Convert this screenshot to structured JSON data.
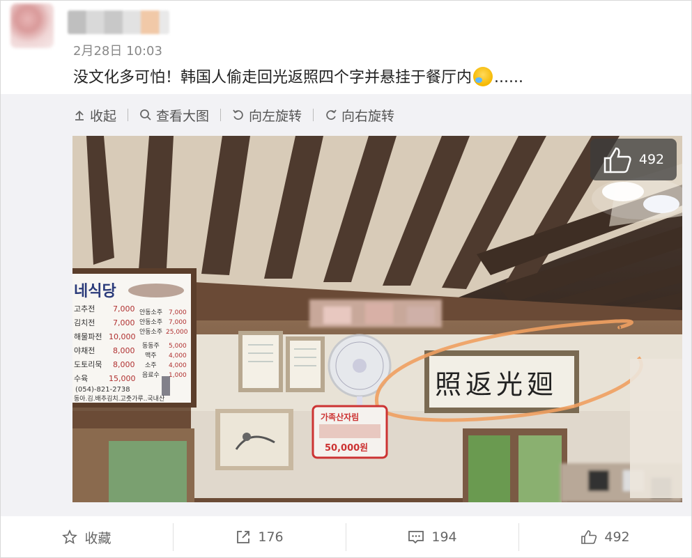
{
  "post": {
    "timestamp": "2月28日 10:03",
    "text": "没文化多可怕！韩国人偷走回光返照四个字并悬挂于餐厅内",
    "ellipsis": "......"
  },
  "toolbar": {
    "collapse": "收起",
    "view_large": "查看大图",
    "rotate_left": "向左旋转",
    "rotate_right": "向右旋转"
  },
  "photo": {
    "like_count": "492",
    "banner_text": "照返光廻",
    "menu_title": "네식당",
    "menu_items": [
      {
        "name": "고추전",
        "price": "7,000"
      },
      {
        "name": "김치전",
        "price": "7,000"
      },
      {
        "name": "해물파전",
        "price": "10,000"
      },
      {
        "name": "야채전",
        "price": "8,000"
      },
      {
        "name": "도토리묵",
        "price": "8,000"
      },
      {
        "name": "수육",
        "price": "15,000"
      }
    ],
    "menu_right": [
      {
        "name": "안동소주",
        "price": "7,000"
      },
      {
        "name": "안동소주",
        "price": "7,000"
      },
      {
        "name": "안동소주",
        "price": "25,000"
      },
      {
        "name": "동동주",
        "price": "5,000"
      },
      {
        "name": "맥주",
        "price": "4,000"
      },
      {
        "name": "소주",
        "price": "4,000"
      },
      {
        "name": "음료수",
        "price": "1,000"
      }
    ],
    "menu_phone": "(054)-821-2738",
    "menu_footer": "동아.김.배추김치.고춧가루..국내산",
    "sign_title": "가족산자림",
    "sign_price": "50,000원"
  },
  "footer": {
    "favorite": "收藏",
    "share_count": "176",
    "comment_count": "194",
    "like_count": "492"
  },
  "colors": {
    "panel_bg": "#f2f2f5",
    "highlight_circle": "#f0a060",
    "text_main": "#222222",
    "text_muted": "#888888"
  }
}
